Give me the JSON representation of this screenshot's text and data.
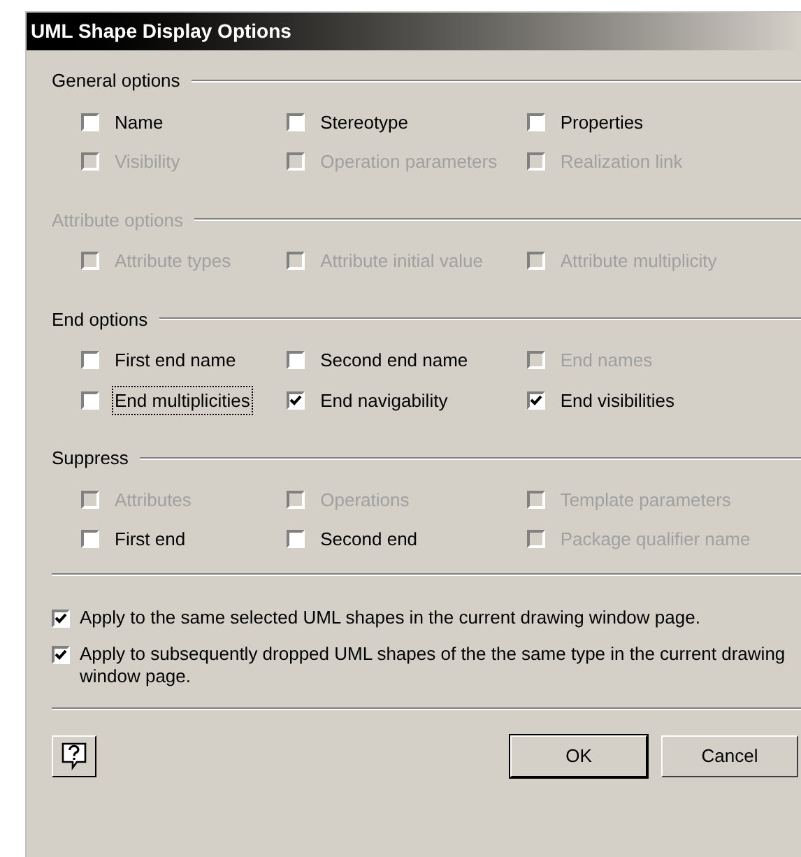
{
  "window": {
    "title": "UML Shape Display Options"
  },
  "groups": [
    {
      "label": "General options",
      "disabled": false,
      "rows": [
        [
          {
            "label": "Name",
            "checked": false,
            "disabled": false,
            "focused": false
          },
          {
            "label": "Stereotype",
            "checked": false,
            "disabled": false,
            "focused": false
          },
          {
            "label": "Properties",
            "checked": false,
            "disabled": false,
            "focused": false
          }
        ],
        [
          {
            "label": "Visibility",
            "checked": false,
            "disabled": true,
            "focused": false
          },
          {
            "label": "Operation parameters",
            "checked": false,
            "disabled": true,
            "focused": false
          },
          {
            "label": "Realization link",
            "checked": false,
            "disabled": true,
            "focused": false
          }
        ]
      ]
    },
    {
      "label": "Attribute options",
      "disabled": true,
      "rows": [
        [
          {
            "label": "Attribute types",
            "checked": false,
            "disabled": true,
            "focused": false
          },
          {
            "label": "Attribute initial value",
            "checked": false,
            "disabled": true,
            "focused": false
          },
          {
            "label": "Attribute multiplicity",
            "checked": false,
            "disabled": true,
            "focused": false
          }
        ]
      ]
    },
    {
      "label": "End options",
      "disabled": false,
      "rows": [
        [
          {
            "label": "First end name",
            "checked": false,
            "disabled": false,
            "focused": false
          },
          {
            "label": "Second end name",
            "checked": false,
            "disabled": false,
            "focused": false
          },
          {
            "label": "End names",
            "checked": false,
            "disabled": true,
            "focused": false
          }
        ],
        [
          {
            "label": "End multiplicities",
            "checked": false,
            "disabled": false,
            "focused": true
          },
          {
            "label": "End navigability",
            "checked": true,
            "disabled": false,
            "focused": false
          },
          {
            "label": "End visibilities",
            "checked": true,
            "disabled": false,
            "focused": false
          }
        ]
      ]
    },
    {
      "label": "Suppress",
      "disabled": false,
      "rows": [
        [
          {
            "label": "Attributes",
            "checked": false,
            "disabled": true,
            "focused": false
          },
          {
            "label": "Operations",
            "checked": false,
            "disabled": true,
            "focused": false
          },
          {
            "label": "Template parameters",
            "checked": false,
            "disabled": true,
            "focused": false
          }
        ],
        [
          {
            "label": "First end",
            "checked": false,
            "disabled": false,
            "focused": false
          },
          {
            "label": "Second end",
            "checked": false,
            "disabled": false,
            "focused": false
          },
          {
            "label": "Package qualifier name",
            "checked": false,
            "disabled": true,
            "focused": false
          }
        ]
      ]
    }
  ],
  "apply_options": [
    {
      "label": "Apply to the same selected UML shapes in the current drawing window page.",
      "checked": true
    },
    {
      "label": "Apply to subsequently dropped UML shapes of the the same type in the current drawing window page.",
      "checked": true
    }
  ],
  "buttons": [
    "OK",
    "Cancel"
  ]
}
